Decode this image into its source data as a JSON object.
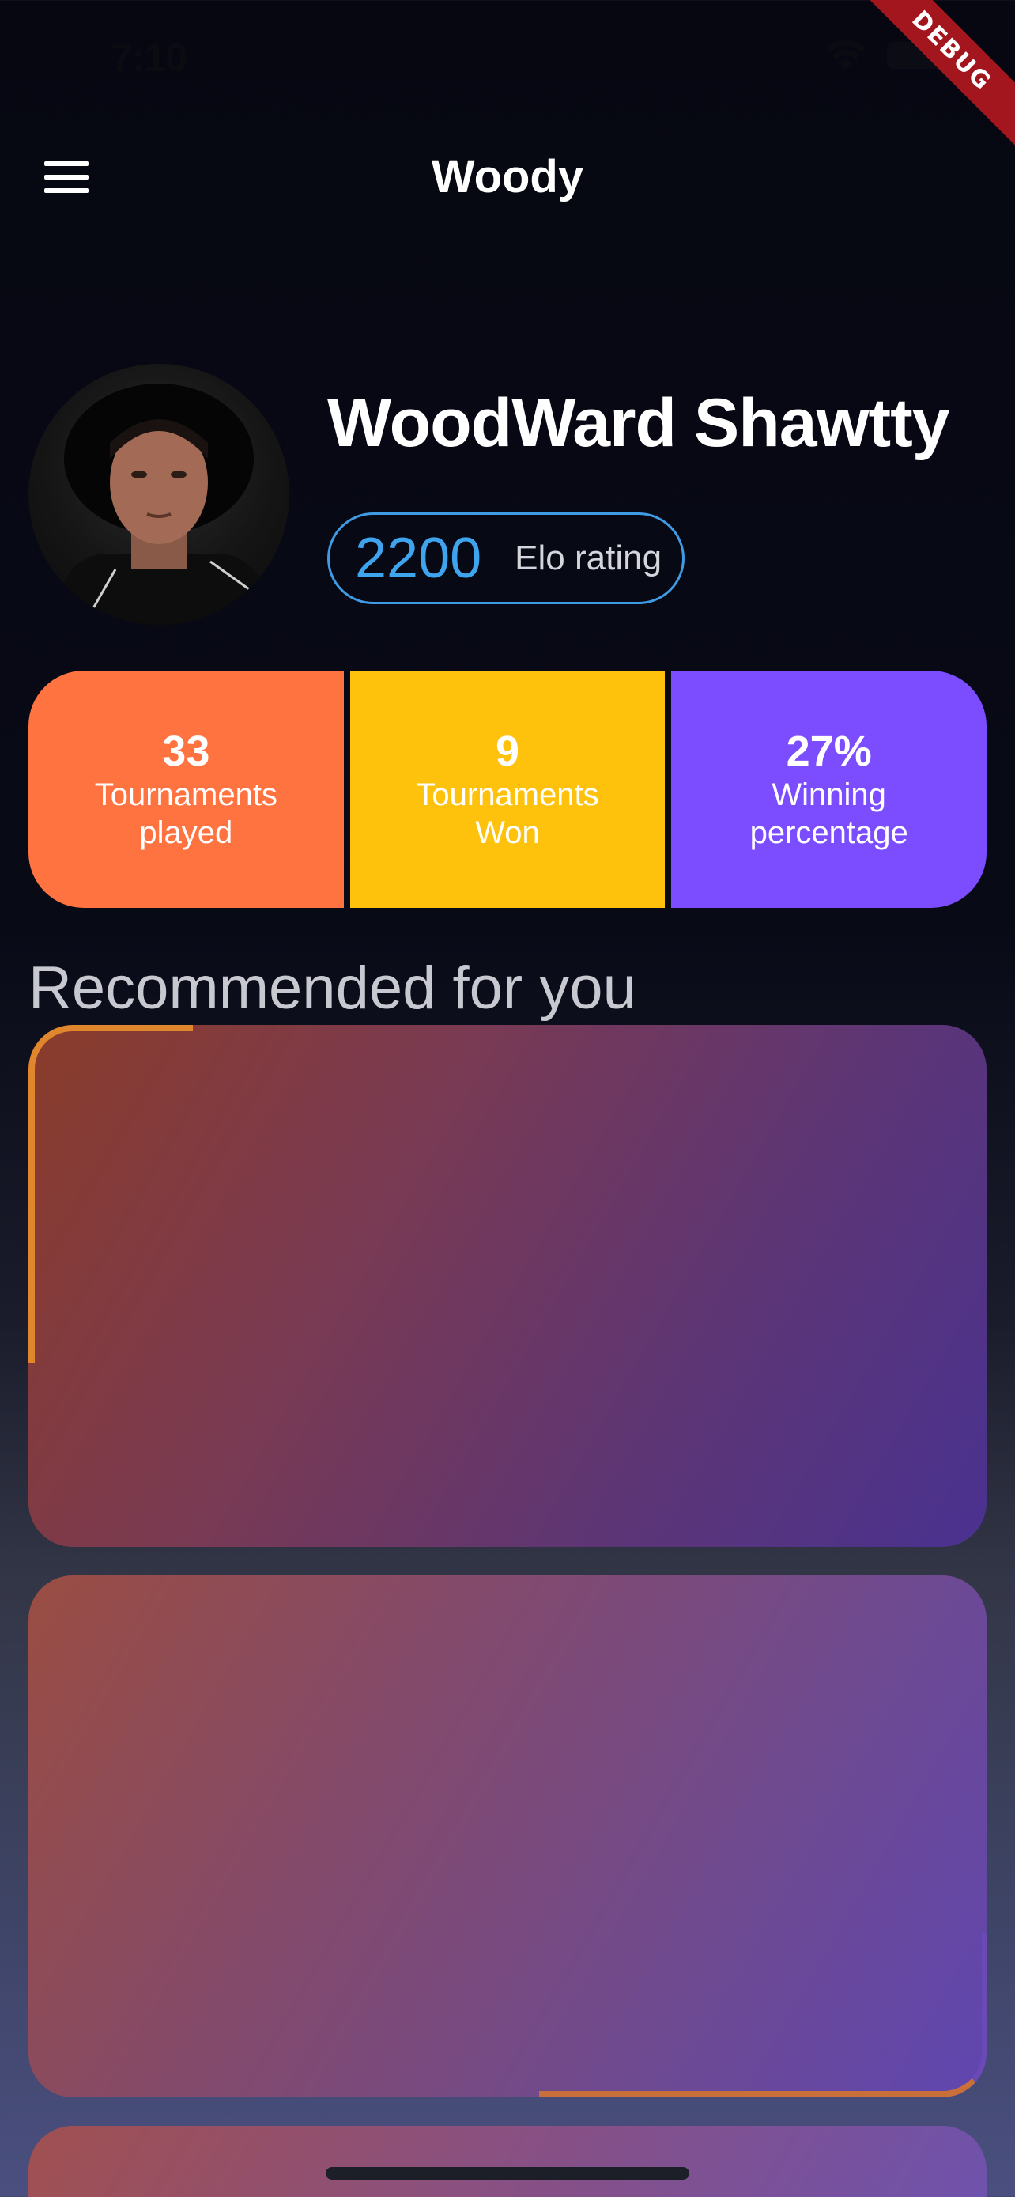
{
  "status_bar": {
    "time": "7:10"
  },
  "debug_banner": "DEBUG",
  "app_bar": {
    "title": "Woody"
  },
  "profile": {
    "name": "WoodWard Shawtty",
    "elo": {
      "value": "2200",
      "label": "Elo rating"
    }
  },
  "stats": [
    {
      "value": "33",
      "label": "Tournaments played",
      "color": "#ff7340"
    },
    {
      "value": "9",
      "label": "Tournaments Won",
      "color": "#fec20c"
    },
    {
      "value": "27%",
      "label": "Winning percentage",
      "color": "#7b4dff"
    }
  ],
  "recommended": {
    "title": "Recommended for you"
  },
  "colors": {
    "accent": "#3f9be3",
    "background": "#060711"
  }
}
